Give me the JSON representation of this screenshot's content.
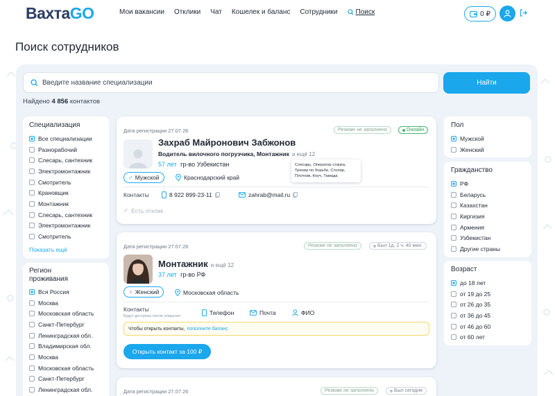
{
  "header": {
    "logo_part1": "Вахта",
    "logo_part2": "GO",
    "nav": [
      "Мои вакансии",
      "Отклики",
      "Чат",
      "Кошелек и баланс",
      "Сотрудники"
    ],
    "nav_search": "Поиск",
    "balance": "0 ₽"
  },
  "page_title": "Поиск сотрудников",
  "search": {
    "placeholder": "Введите название специализации",
    "button": "Найти",
    "found_prefix": "Найдено",
    "found_count": "4 856",
    "found_suffix": "контактов"
  },
  "filters_left": {
    "specialization": {
      "title": "Специализация",
      "options": [
        {
          "label": "Все специализации",
          "checked": true
        },
        {
          "label": "Разнорабочий",
          "checked": false
        },
        {
          "label": "Слесарь, сантехник",
          "checked": false
        },
        {
          "label": "Электромонтажник",
          "checked": false
        },
        {
          "label": "Смотритель",
          "checked": false
        },
        {
          "label": "Крановщик",
          "checked": false
        },
        {
          "label": "Монтажник",
          "checked": false
        },
        {
          "label": "Слесарь, сантехник",
          "checked": false
        },
        {
          "label": "Электромонтажник",
          "checked": false
        },
        {
          "label": "Смотритель",
          "checked": false
        }
      ],
      "more": "Показать ещё"
    },
    "region": {
      "title": "Регион проживания",
      "options": [
        {
          "label": "Вся Россия",
          "checked": true
        },
        {
          "label": "Москва",
          "checked": false
        },
        {
          "label": "Московская область",
          "checked": false
        },
        {
          "label": "Санкт-Петербург",
          "checked": false
        },
        {
          "label": "Ленинградская обл.",
          "checked": false
        },
        {
          "label": "Владимирская обл.",
          "checked": false
        },
        {
          "label": "Москва",
          "checked": false
        },
        {
          "label": "Московская область",
          "checked": false
        },
        {
          "label": "Санкт-Петербург",
          "checked": false
        },
        {
          "label": "Ленинградская обл.",
          "checked": false
        }
      ]
    }
  },
  "filters_right": {
    "gender": {
      "title": "Пол",
      "options": [
        {
          "label": "Мужской",
          "checked": true
        },
        {
          "label": "Женский",
          "checked": false
        }
      ]
    },
    "citizenship": {
      "title": "Гражданство",
      "options": [
        {
          "label": "РФ",
          "checked": true
        },
        {
          "label": "Беларусь",
          "checked": false
        },
        {
          "label": "Казахстан",
          "checked": false
        },
        {
          "label": "Киргизия",
          "checked": false
        },
        {
          "label": "Армения",
          "checked": false
        },
        {
          "label": "Узбекистан",
          "checked": false
        },
        {
          "label": "Другие страны",
          "checked": false
        }
      ]
    },
    "age": {
      "title": "Возраст",
      "options": [
        {
          "label": "до 18 лет",
          "checked": true
        },
        {
          "label": "от 19 до 25",
          "checked": false
        },
        {
          "label": "от 26 до 35",
          "checked": false
        },
        {
          "label": "от 36 до 45",
          "checked": false
        },
        {
          "label": "от 46 до 60",
          "checked": false
        },
        {
          "label": "от 60 лет",
          "checked": false
        }
      ]
    }
  },
  "cards": [
    {
      "reg_date": "Дата регистрации 27.07.26",
      "resume_status": "Резюме не заполнено",
      "online": "Онлайн",
      "name": "Захраб Майронович Забжонов",
      "profession": "Водитель вилочного погрузчика, Монтажник",
      "more": "и ещё 12",
      "age": "57 лет",
      "citizenship": "гр-во Узбекистан",
      "gender": "Мужской",
      "location": "Краснодарский край",
      "contacts_label": "Контакты",
      "phone": "8 922 899-23-11",
      "email": "zahrab@mail.ru",
      "responded": "Есть отклик",
      "tooltip": "Слесарь, Оператор станка, Тренер по борьбе, Столяр, Плотник, Коуч, Тамада"
    },
    {
      "reg_date": "Дата регистрации 27.07.26",
      "resume_status": "Резюме не заполнено",
      "last_seen": "Был 1д. 2 ч. 40 мин.",
      "name": "Монтажник",
      "more": "и ещё 12",
      "age": "37 лет",
      "citizenship": "гр-во РФ",
      "gender": "Женский",
      "location": "Московская область",
      "contacts_label": "Контакты",
      "contacts_sub": "Будут доступны после открытия",
      "phone": "Телефон",
      "email": "Почта",
      "fio": "ФИО",
      "notice": "Чтобы открыть контакты,",
      "notice_link": "пополните баланс",
      "open_button": "Открыть контакт за 100 ₽"
    },
    {
      "reg_date": "Дата регистрации 27.07.26",
      "resume_status": "Резюме не заполнено",
      "last_seen": "Был сегодня"
    }
  ]
}
